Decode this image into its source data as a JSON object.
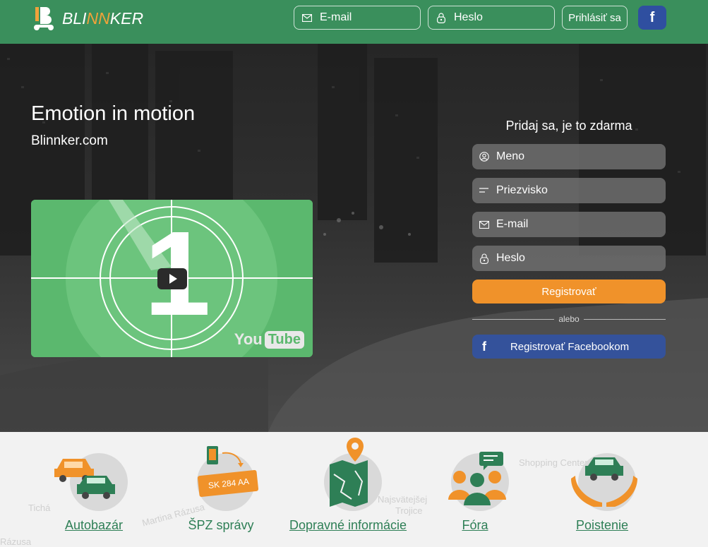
{
  "header": {
    "logo_prefix": "BLI",
    "logo_accent": "NN",
    "logo_suffix": "KER",
    "email_placeholder": "E-mail",
    "password_placeholder": "Heslo",
    "login_label": "Prihlásiť sa",
    "facebook_label": "f"
  },
  "hero": {
    "tagline": "Emotion in motion",
    "site": "Blinnker.com",
    "video": {
      "countdown_number": "1",
      "youtube_you": "You",
      "youtube_tube": "Tube"
    }
  },
  "register": {
    "title": "Pridaj sa, je to zdarma",
    "name_placeholder": "Meno",
    "surname_placeholder": "Priezvisko",
    "email_placeholder": "E-mail",
    "password_placeholder": "Heslo",
    "submit_label": "Registrovať",
    "or_label": "alebo",
    "facebook_f": "f",
    "facebook_label": "Registrovať Facebookom"
  },
  "services": [
    {
      "label": "Autobazár",
      "icon": "cars-icon"
    },
    {
      "label": "ŠPZ správy",
      "icon": "license-plate-icon",
      "plate": "SK 284 AA"
    },
    {
      "label": "Dopravné informácie",
      "icon": "map-pin-icon"
    },
    {
      "label": "Fóra",
      "icon": "forum-people-icon"
    },
    {
      "label": "Poistenie",
      "icon": "insurance-hands-icon"
    }
  ],
  "colors": {
    "header_green": "#3a8f5c",
    "accent_orange": "#f0922a",
    "facebook_blue": "#34529b",
    "link_green": "#2e7f56"
  }
}
